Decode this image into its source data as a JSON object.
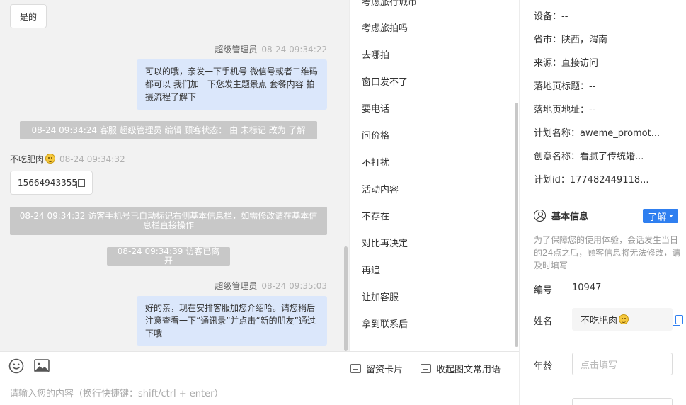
{
  "chat": {
    "msg_yes": "是的",
    "admin_name": "超级管理员",
    "msg1_time": "08-24 09:34:22",
    "msg1_text": "可以的哦，亲发一下手机号 微信号或者二维码都可以 我们加一下您发主题景点 套餐内容 拍摄流程了解下",
    "sys1": "08-24 09:34:24 客服 超级管理员 编辑 顾客状态： 由 未标记 改为 了解",
    "visitor_name": "不吃肥肉",
    "visitor_time": "08-24 09:34:32",
    "visitor_phone": "15664943355",
    "sys2": "08-24 09:34:32 访客手机号已自动标记右侧基本信息栏，如需修改请在基本信息栏直接操作",
    "sys3": "08-24 09:34:39 访客已离开",
    "msg2_time": "08-24 09:35:03",
    "msg2_text": "好的亲，现在安排客服加您介绍哈。请您稍后注意查看一下“通讯录”并点击“新的朋友”通过下哦"
  },
  "composer": {
    "placeholder": "请输入您的内容（换行快捷键：shift/ctrl + enter）",
    "card_button": "留资卡片",
    "collapse_button": "收起图文常用语",
    "emoji_icon": "smile-icon",
    "image_icon": "image-icon"
  },
  "quick_replies": {
    "items": [
      "考虑旅拍吗",
      "去哪拍",
      "窗口发不了",
      "要电话",
      "问价格",
      "不打扰",
      "活动内容",
      "不存在",
      "对比再决定",
      "再追",
      "让加客服",
      "拿到联系后"
    ],
    "partial_top": "考虑旅行城市"
  },
  "info": {
    "device": "设备：--",
    "province": "省市：陕西，渭南",
    "source": "来源：直接访问",
    "landing_title": "落地页标题：--",
    "landing_url": "落地页地址：--",
    "plan_name": "计划名称：aweme_promot...",
    "creative_name": "创意名称：看腻了传统婚...",
    "plan_id": "计划id：177482449118...",
    "section_title": "基本信息",
    "learn_label": "了解",
    "notice": "为了保障您的使用体验，会话发生当日的24点之后，顾客信息将无法修改，请及时填写",
    "id_label": "编号",
    "id_value": "10947",
    "name_label": "姓名",
    "name_value": "不吃肥肉",
    "age_label": "年龄",
    "age_placeholder": "点击填写"
  }
}
